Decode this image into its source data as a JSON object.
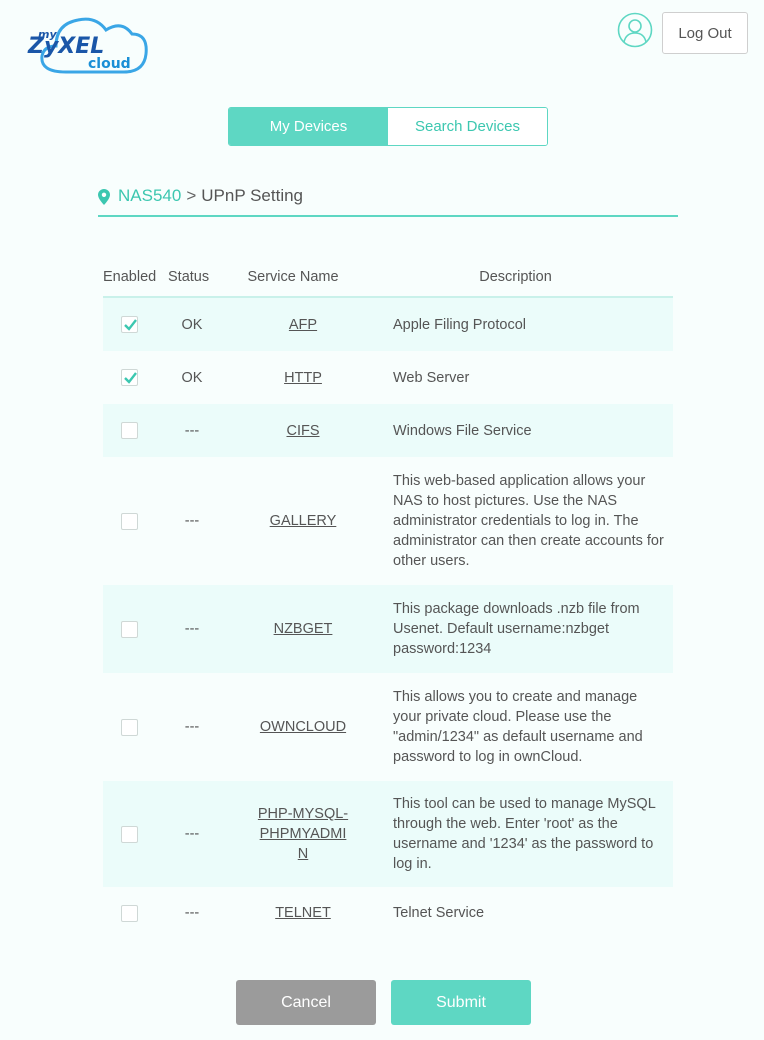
{
  "logo": {
    "my": "my",
    "brand": "ZyXEL",
    "cloud": "cloud"
  },
  "header": {
    "logout_label": "Log Out"
  },
  "tabs": [
    {
      "label": "My Devices",
      "active": true
    },
    {
      "label": "Search Devices",
      "active": false
    }
  ],
  "breadcrumb": {
    "device": "NAS540",
    "separator": ">",
    "page": "UPnP Setting"
  },
  "table": {
    "headers": {
      "enabled": "Enabled",
      "status": "Status",
      "name": "Service Name",
      "description": "Description"
    },
    "rows": [
      {
        "enabled": true,
        "status": "OK",
        "name": "AFP",
        "description": "Apple Filing Protocol"
      },
      {
        "enabled": true,
        "status": "OK",
        "name": "HTTP",
        "description": "Web Server"
      },
      {
        "enabled": false,
        "status": "---",
        "name": "CIFS",
        "description": "Windows File Service"
      },
      {
        "enabled": false,
        "status": "---",
        "name": "GALLERY",
        "description": "This web-based application allows your NAS to host pictures. Use the NAS administrator credentials to log in. The administrator can then create accounts for other users."
      },
      {
        "enabled": false,
        "status": "---",
        "name": "NZBGET",
        "description": "This package downloads .nzb file from Usenet. Default username:nzbget password:1234"
      },
      {
        "enabled": false,
        "status": "---",
        "name": "OWNCLOUD",
        "description": "This allows you to create and manage your private cloud. Please use the \"admin/1234\" as default username and password to log in ownCloud."
      },
      {
        "enabled": false,
        "status": "---",
        "name": "PHP-MYSQL-PHPMYADMIN",
        "description": "This tool can be used to manage MySQL through the web. Enter 'root' as the username and '1234' as the password to log in."
      },
      {
        "enabled": false,
        "status": "---",
        "name": "TELNET",
        "description": "Telnet Service"
      }
    ]
  },
  "buttons": {
    "cancel": "Cancel",
    "submit": "Submit"
  },
  "colors": {
    "accent": "#5ed7c3",
    "brand": "#1a56a8",
    "row_shade": "#ebfcfa",
    "cancel": "#9b9b9b"
  }
}
